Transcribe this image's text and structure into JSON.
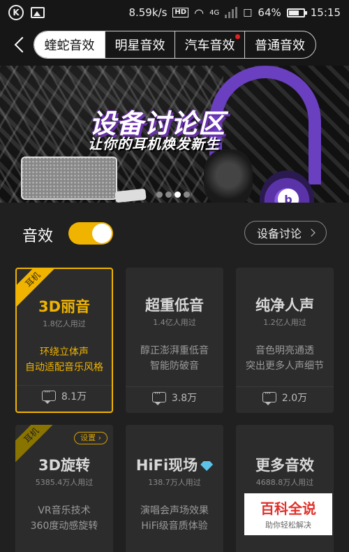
{
  "status_bar": {
    "speed": "8.59k/s",
    "hd": "HD",
    "network": "4G",
    "battery": "64%",
    "time": "15:15"
  },
  "nav": {
    "tabs": [
      {
        "label": "蝰蛇音效",
        "active": true
      },
      {
        "label": "明星音效",
        "active": false
      },
      {
        "label": "汽车音效",
        "active": false,
        "badge": true
      },
      {
        "label": "普通音效",
        "active": false
      }
    ]
  },
  "banner": {
    "title": "设备讨论区",
    "subtitle": "让你的耳机焕发新生",
    "slide_count": 4,
    "active_slide": 2
  },
  "sound_effect": {
    "label": "音效",
    "enabled": true,
    "discuss_label": "设备讨论"
  },
  "cards": [
    {
      "name": "3D丽音",
      "users": "1.8亿人用过",
      "desc1": "环绕立体声",
      "desc2": "自动适配音乐风格",
      "count": "8.1万",
      "ribbon": "耳机",
      "selected": true
    },
    {
      "name": "超重低音",
      "users": "1.4亿人用过",
      "desc1": "醇正澎湃重低音",
      "desc2": "智能防破音",
      "count": "3.8万"
    },
    {
      "name": "纯净人声",
      "users": "1.2亿人用过",
      "desc1": "音色明亮通透",
      "desc2": "突出更多人声细节",
      "count": "2.0万"
    },
    {
      "name": "3D旋转",
      "users": "5385.4万人用过",
      "desc1": "VR音乐技术",
      "desc2": "360度动感旋转",
      "ribbon": "耳机",
      "settings": "设置"
    },
    {
      "name": "HiFi现场",
      "users": "138.7万人用过",
      "desc1": "演唱会声场效果",
      "desc2": "HiFi级音质体验"
    },
    {
      "name": "更多音效",
      "users": "4688.8万人用过"
    }
  ],
  "watermark": {
    "title": "百科全说",
    "subtitle": "助你轻松解决"
  },
  "colors": {
    "accent": "#f0b400",
    "background": "#202020",
    "card": "#2c2c2c",
    "badge": "#e52020"
  }
}
